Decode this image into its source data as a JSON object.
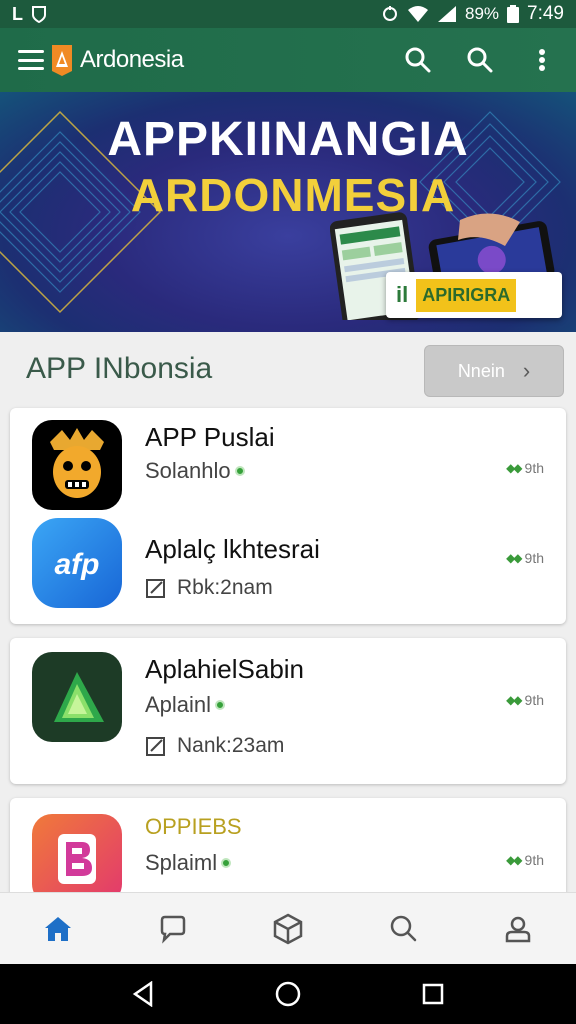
{
  "status_bar": {
    "left_text": "L",
    "battery": "89%",
    "time": "7:49"
  },
  "app_bar": {
    "title": "Ardonesia",
    "icons": [
      "menu-icon",
      "search-icon",
      "search-icon",
      "more-vertical-icon"
    ]
  },
  "banner": {
    "title_line1": "APPKIINANGIA",
    "title_line2": "ARDONMESIA",
    "badge_prefix": "il",
    "badge_label": "APIRIGRA",
    "slides": 3,
    "active_slide": 3
  },
  "section": {
    "title": "APP INbonsia",
    "more_label": "Nnein"
  },
  "apps": [
    {
      "name": "APP Puslai",
      "subtitle": "Solanhlo",
      "meta": "",
      "size": "9th",
      "icon": "lion-mask-icon"
    },
    {
      "name": "Aplalç lkhtesrai",
      "subtitle": "",
      "meta": "Rbk:2nam",
      "size": "9th",
      "icon": "afp-logo-icon"
    },
    {
      "name": "AplahielSabin",
      "subtitle": "Aplainl",
      "meta": "Nank:23am",
      "size": "9th",
      "icon": "green-arrow-icon"
    },
    {
      "name": "OPPIEBS",
      "subtitle": "Splaiml",
      "meta": "",
      "size": "9th",
      "icon": "b-logo-icon"
    }
  ],
  "colors": {
    "app_bar": "#1f6b49",
    "accent_yellow": "#f2cf3b",
    "nav_active": "#1e6fc7"
  },
  "bottom_nav": [
    "home-icon",
    "chat-icon",
    "box-icon",
    "search-chat-icon",
    "profile-icon"
  ]
}
